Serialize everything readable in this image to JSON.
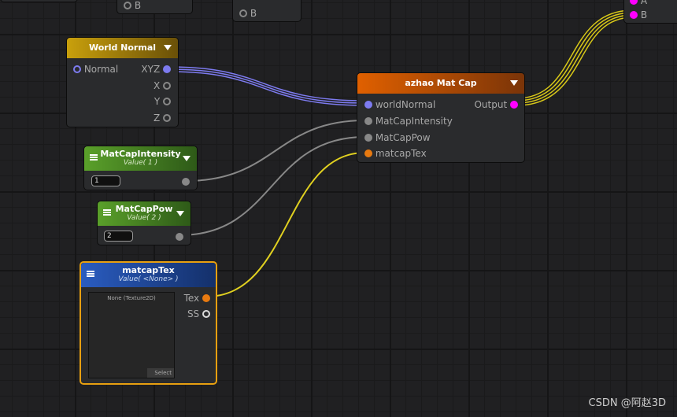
{
  "colors": {
    "vector": "#7d7bf0",
    "float": "#8a8a8a",
    "texture": "#e87a10",
    "output": "#ff00ff",
    "wire_yellow": "#e0d020"
  },
  "partial_nodes": [
    {
      "port": "B"
    },
    {
      "port": "B"
    },
    {
      "ports": [
        "A",
        "B"
      ]
    }
  ],
  "world_normal": {
    "title": "World Normal",
    "input": "Normal",
    "outputs": [
      "XYZ",
      "X",
      "Y",
      "Z"
    ]
  },
  "mat_cap": {
    "title": "azhao Mat Cap",
    "inputs": [
      "worldNormal",
      "MatCapIntensity",
      "MatCapPow",
      "matcapTex"
    ],
    "output": "Output"
  },
  "intensity": {
    "title": "MatCapIntensity",
    "subtitle": "Value( 1 )",
    "value": "1"
  },
  "pow": {
    "title": "MatCapPow",
    "subtitle": "Value( 2 )",
    "value": "2"
  },
  "tex": {
    "title": "matcapTex",
    "subtitle": "Value( <None> )",
    "preview_label": "None (Texture2D)",
    "select": "Select",
    "outputs": [
      "Tex",
      "SS"
    ]
  },
  "watermark": "CSDN @阿赵3D"
}
